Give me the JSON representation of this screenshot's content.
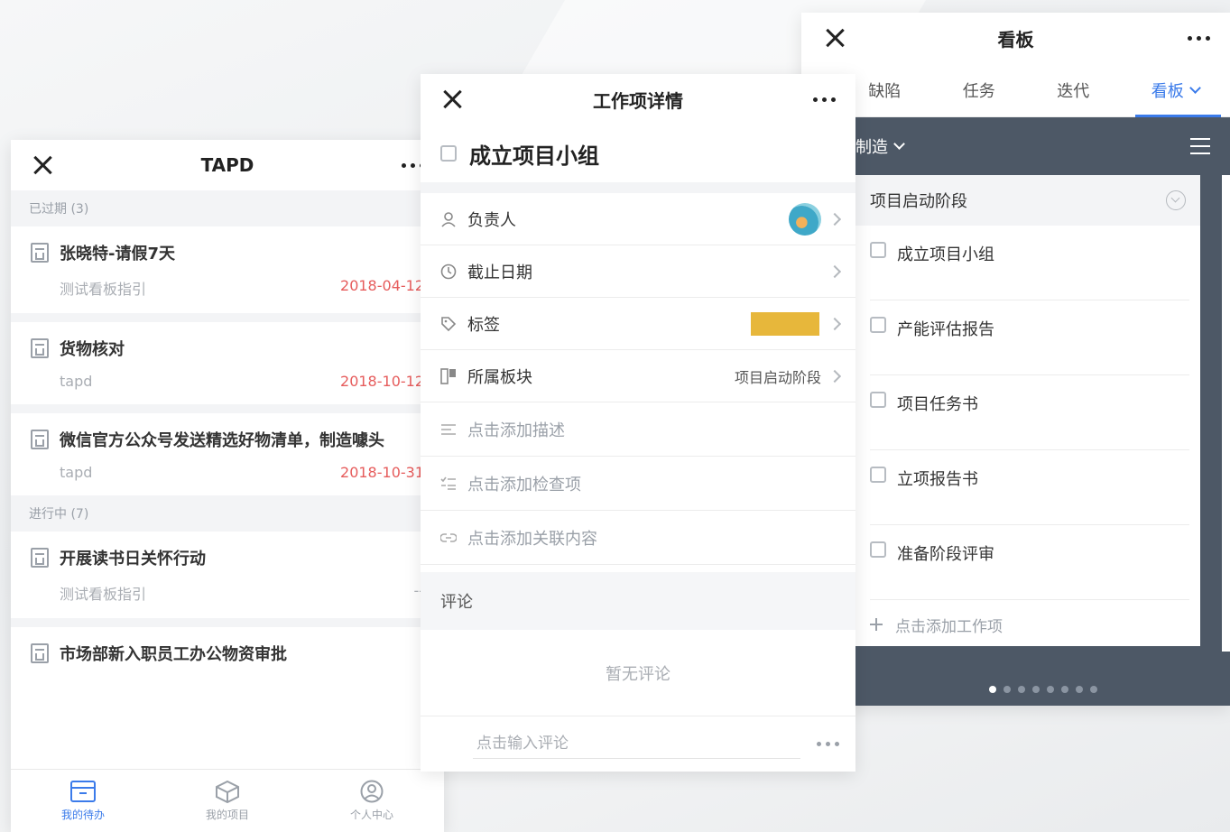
{
  "list_screen": {
    "title": "TAPD",
    "sections": [
      {
        "header": "已过期 (3)",
        "items": [
          {
            "title": "张晓特-请假7天",
            "sub": "测试看板指引",
            "date": "2018-04-12"
          },
          {
            "title": "货物核对",
            "sub": "tapd",
            "date": "2018-10-12"
          },
          {
            "title": "微信官方公众号发送精选好物清单，制造噱头",
            "sub": "tapd",
            "date": "2018-10-31"
          }
        ]
      },
      {
        "header": "进行中 (7)",
        "items": [
          {
            "title": "开展读书日关怀行动",
            "sub": "测试看板指引",
            "date": "--"
          },
          {
            "title": "市场部新入职员工办公物资审批",
            "sub": "",
            "date": ""
          }
        ]
      }
    ],
    "tabbar": [
      {
        "label": "我的待办",
        "icon": "inbox-icon",
        "active": true
      },
      {
        "label": "我的项目",
        "icon": "cube-icon",
        "active": false
      },
      {
        "label": "个人中心",
        "icon": "user-icon",
        "active": false
      }
    ]
  },
  "detail_screen": {
    "title": "工作项详情",
    "item_title": "成立项目小组",
    "fields": [
      {
        "label": "负责人",
        "icon": "person-icon",
        "type": "avatar"
      },
      {
        "label": "截止日期",
        "icon": "clock-icon",
        "type": "empty"
      },
      {
        "label": "标签",
        "icon": "tag-icon",
        "type": "tag",
        "color": "#e7b73b"
      },
      {
        "label": "所属板块",
        "icon": "board-icon",
        "type": "text",
        "value": "项目启动阶段"
      }
    ],
    "add_rows": [
      {
        "label": "点击添加描述",
        "icon": "description-icon"
      },
      {
        "label": "点击添加检查项",
        "icon": "checklist-icon"
      },
      {
        "label": "点击添加关联内容",
        "icon": "link-icon"
      }
    ],
    "comment_header": "评论",
    "empty_comment": "暂无评论",
    "comment_placeholder": "点击输入评论"
  },
  "kanban_screen": {
    "title": "看板",
    "tabs": [
      {
        "label": "缺陷",
        "active": false
      },
      {
        "label": "任务",
        "active": false
      },
      {
        "label": "迭代",
        "active": false
      },
      {
        "label": "看板",
        "active": true
      }
    ],
    "board_name": "制造",
    "column_title": "项目启动阶段",
    "cards": [
      "成立项目小组",
      "产能评估报告",
      "项目任务书",
      "立项报告书",
      "准备阶段评审"
    ],
    "add_card": "点击添加工作项",
    "page_dots": 8,
    "active_dot": 0
  },
  "colors": {
    "accent": "#3b7bea",
    "overdue": "#e65c5c",
    "kanban_bg": "#4d5866",
    "tag_yellow": "#e7b73b"
  }
}
